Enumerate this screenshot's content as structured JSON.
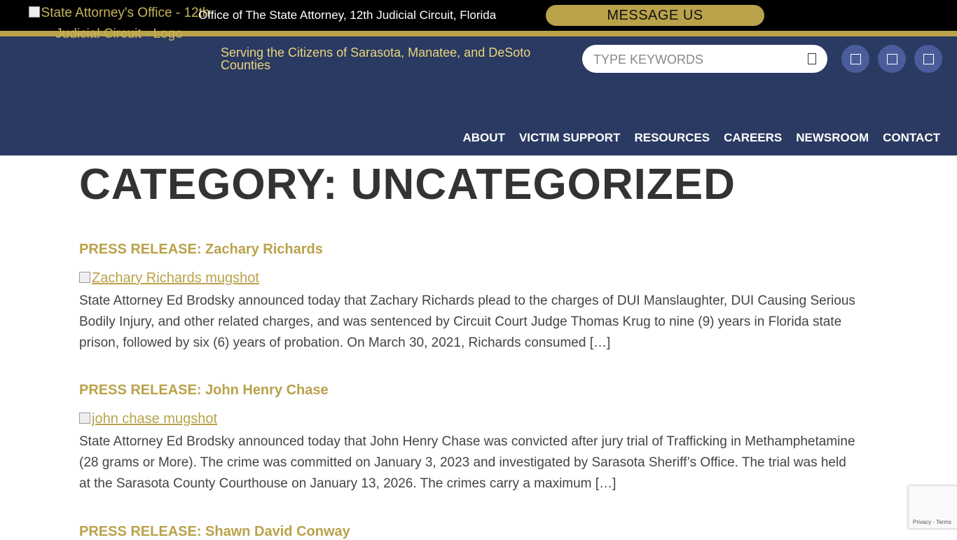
{
  "header": {
    "logo_alt": "State Attorney's Office - 12th Judicial Circuit - Logo",
    "site_title": "Office of The State Attorney, 12th Judicial Circuit, Florida",
    "message_button": "MESSAGE US",
    "tagline": "Serving the Citizens of Sarasota, Manatee, and DeSoto Counties",
    "search_placeholder": "TYPE KEYWORDS",
    "social_icons": [
      "facebook-icon",
      "twitter-icon",
      "instagram-icon"
    ]
  },
  "nav": {
    "items": [
      {
        "label": "ABOUT"
      },
      {
        "label": "VICTIM SUPPORT"
      },
      {
        "label": "RESOURCES"
      },
      {
        "label": "CAREERS"
      },
      {
        "label": "NEWSROOM"
      },
      {
        "label": "CONTACT"
      }
    ]
  },
  "page": {
    "title": "CATEGORY: UNCATEGORIZED"
  },
  "posts": [
    {
      "title": "PRESS RELEASE: Zachary Richards",
      "image_alt": "Zachary Richards mugshot",
      "excerpt": "State Attorney Ed Brodsky announced today that Zachary Richards plead to the charges of DUI Manslaughter, DUI Causing Serious Bodily Injury, and other related charges, and was sentenced by Circuit Court Judge Thomas Krug to nine (9) years in Florida state prison, followed by six (6) years of probation. On March 30, 2021, Richards consumed […]"
    },
    {
      "title": "PRESS RELEASE: John Henry Chase",
      "image_alt": "john chase mugshot",
      "excerpt": "State Attorney Ed Brodsky announced today that John Henry Chase was convicted after jury trial of Trafficking in Methamphetamine (28 grams or More).  The crime was committed on January 3, 2023 and investigated by Sarasota Sheriff’s Office.  The trial was held at the Sarasota County Courthouse on January 13, 2026. The crimes carry a maximum […]"
    },
    {
      "title": "PRESS RELEASE: Shawn David Conway"
    }
  ],
  "recaptcha": {
    "text": "Privacy - Terms"
  },
  "colors": {
    "header_bg": "#2b3a62",
    "gold": "#b9a24a",
    "tagline": "#e8d67e"
  }
}
